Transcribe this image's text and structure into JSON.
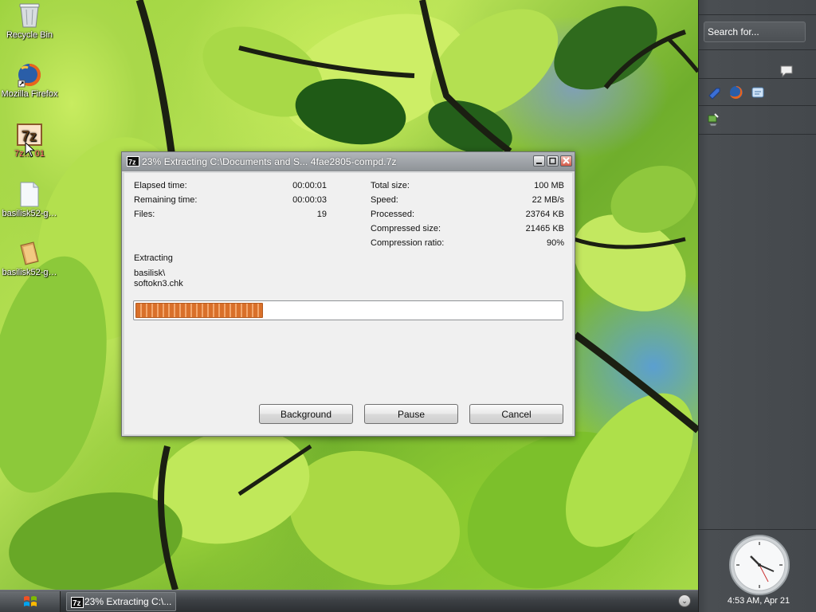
{
  "desktop": {
    "icons": [
      {
        "label": "Recycle Bin",
        "icon": "recycle-bin-icon"
      },
      {
        "label": "Mozilla Firefox",
        "icon": "firefox-icon"
      },
      {
        "label": "7z… 01",
        "icon": "7zip-icon"
      },
      {
        "label": "basilisk52-g…",
        "icon": "document-icon"
      },
      {
        "label": "basilisk52-g…",
        "icon": "archive-icon"
      }
    ]
  },
  "sidebar": {
    "search_placeholder": "Search for...",
    "clock_text": "4:53 AM, Apr 21",
    "icons": [
      "chat-bubble-icon",
      "arrow-app-icon",
      "firefox-icon",
      "folder-app-icon",
      "network-tool-icon"
    ]
  },
  "taskbar": {
    "start_icon": "windows-logo-icon",
    "task_label": "23% Extracting C:\\...",
    "task_icon": "7zip-icon"
  },
  "dialog": {
    "title": "23% Extracting C:\\Documents and S... 4fae2805-compd.7z",
    "stats_left": [
      {
        "label": "Elapsed time:",
        "value": "00:00:01"
      },
      {
        "label": "Remaining time:",
        "value": "00:00:03"
      },
      {
        "label": "Files:",
        "value": "19"
      }
    ],
    "stats_right": [
      {
        "label": "Total size:",
        "value": "100 MB"
      },
      {
        "label": "Speed:",
        "value": "22 MB/s"
      },
      {
        "label": "Processed:",
        "value": "23764 KB"
      },
      {
        "label": "Compressed size:",
        "value": "21465 KB"
      },
      {
        "label": "Compression ratio:",
        "value": "90%"
      }
    ],
    "action": "Extracting",
    "path_line1": "basilisk\\",
    "path_line2": "softokn3.chk",
    "progress": 0.3,
    "buttons": {
      "background": "Background",
      "pause": "Pause",
      "cancel": "Cancel"
    }
  },
  "colors": {
    "progress": "#d9702a",
    "sidebar": "#44484c",
    "taskbar": "#3d4145"
  }
}
